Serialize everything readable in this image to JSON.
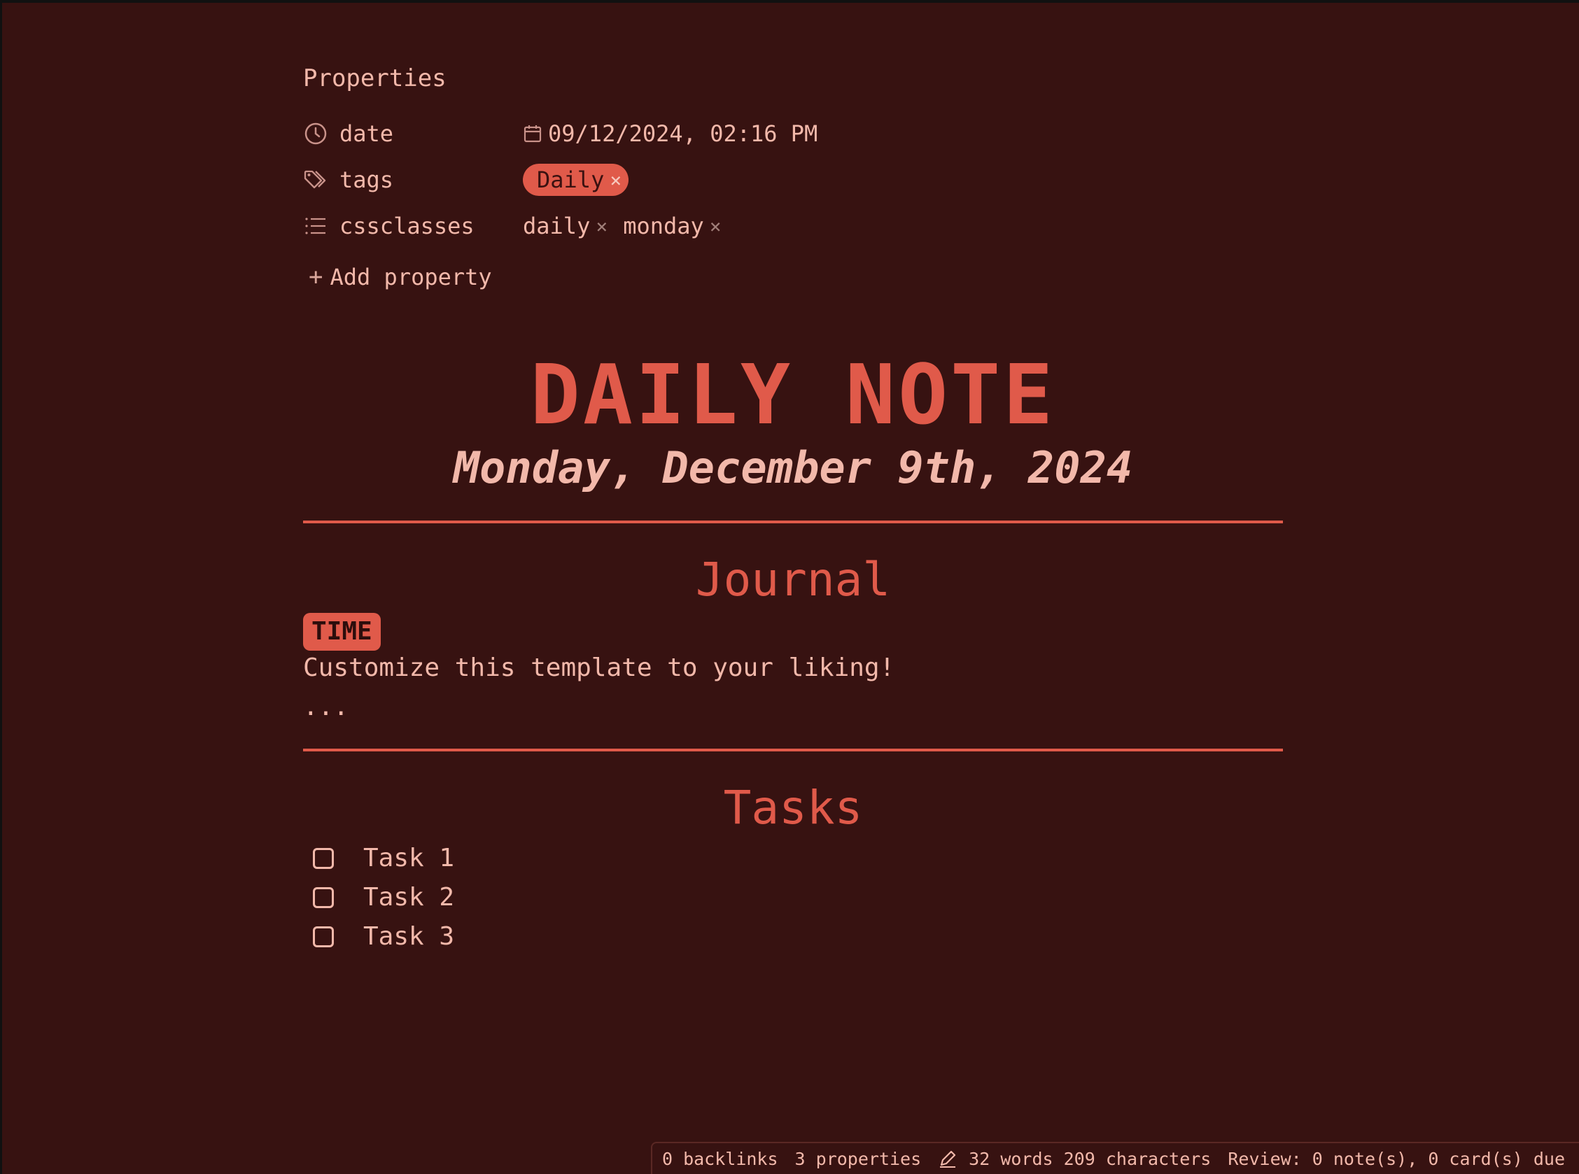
{
  "properties": {
    "title": "Properties",
    "date": {
      "key": "date",
      "icon": "clock-icon",
      "value": "09/12/2024, 02:16 PM"
    },
    "tags": {
      "key": "tags",
      "icon": "tags-icon",
      "values": [
        "Daily"
      ]
    },
    "cssclasses": {
      "key": "cssclasses",
      "icon": "list-icon",
      "values": [
        "daily",
        "monday"
      ]
    },
    "add_label": "Add property"
  },
  "note": {
    "title": "DAILY NOTE",
    "subtitle": "Monday, December 9th, 2024",
    "journal_heading": "Journal",
    "time_badge": "TIME",
    "body_text": "Customize this template to your liking!",
    "ellipsis": "...",
    "tasks_heading": "Tasks",
    "tasks": [
      "Task 1",
      "Task 2",
      "Task 3"
    ]
  },
  "status_bar": {
    "backlinks": "0 backlinks",
    "properties": "3 properties",
    "word_count": "32 words 209 characters",
    "review": "Review: 0 note(s), 0 card(s) due"
  },
  "colors": {
    "background": "#371211",
    "accent": "#e05a4a",
    "text": "#f2b8aa"
  }
}
